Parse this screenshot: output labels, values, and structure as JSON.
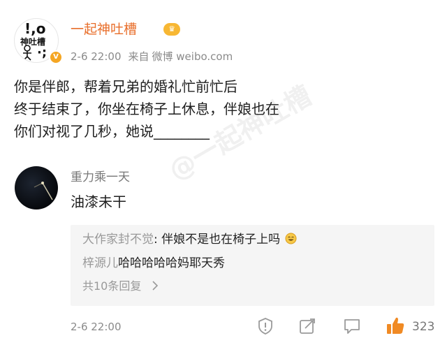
{
  "post": {
    "author": "一起神吐槽",
    "avatar_text": {
      "line1": "!,o",
      "line2": "神吐槽",
      "line3": "·;"
    },
    "timestamp": "2-6 22:00",
    "source_prefix": "来自",
    "source": "微博 weibo.com",
    "text_lines": [
      "你是伴郎，帮着兄弟的婚礼忙前忙后",
      "终于结束了，你坐在椅子上休息，伴娘也在",
      "你们对视了几秒，她说________"
    ],
    "watermark": "@一起神吐槽"
  },
  "comment": {
    "author": "重力乘一天",
    "text": "油漆未干",
    "replies": [
      {
        "author": "大作家封不觉",
        "text": "伴娘不是也在椅子上吗"
      },
      {
        "author": "梓源儿",
        "text": "哈哈哈哈哈妈耶天秀"
      }
    ],
    "more_replies": "共10条回复",
    "timestamp": "2-6 22:00",
    "like_count": "323"
  },
  "icons": {
    "report": "exclamation-shield-icon",
    "share": "share-edit-icon",
    "comment": "comment-bubble-icon",
    "like": "thumbs-up-icon"
  },
  "colors": {
    "author_name": "#e86e2a",
    "meta": "#8a8a8a",
    "like": "#f08a24",
    "reply_bg": "#f5f5f5"
  }
}
